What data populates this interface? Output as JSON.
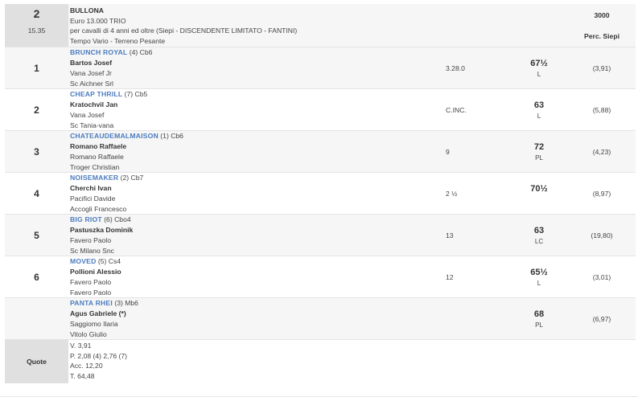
{
  "race": {
    "number": "2",
    "time": "15.35",
    "name": "BULLONA",
    "prize": "Euro 13.000 TRIO",
    "conditions": "per cavalli di 4 anni ed oltre (Siepi -  DISCENDENTE LIMITATO  - FANTINI)",
    "weather": "Tempo Vario - Terreno Pesante",
    "distance": "3000",
    "type": "Perc. Siepi"
  },
  "entries": [
    {
      "pos": "1",
      "horse": "BRUNCH ROYAL",
      "horse_info": "(4) Cb6",
      "jockey": "Bartos Josef",
      "trainer": "Vana Josef Jr",
      "owner": "Sc Aichner Srl",
      "time": "3.28.0",
      "weight": "67½",
      "equip": "L",
      "perc": "(3,91)"
    },
    {
      "pos": "2",
      "horse": "CHEAP THRILL",
      "horse_info": "(7) Cb5",
      "jockey": "Kratochvil Jan",
      "trainer": "Vana Josef",
      "owner": "Sc Tania-vana",
      "time": "C.INC.",
      "weight": "63",
      "equip": "L",
      "perc": "(5,88)"
    },
    {
      "pos": "3",
      "horse": "CHATEAUDEMALMAISON",
      "horse_info": "(1) Cb6",
      "jockey": "Romano Raffaele",
      "trainer": "Romano Raffaele",
      "owner": "Troger Christian",
      "time": "9",
      "weight": "72",
      "equip": "PL",
      "perc": "(4,23)"
    },
    {
      "pos": "4",
      "horse": "NOISEMAKER",
      "horse_info": "(2) Cb7",
      "jockey": "Cherchi Ivan",
      "trainer": "Pacifici Davide",
      "owner": "Accogli Francesco",
      "time": "2 ½",
      "weight": "70½",
      "equip": "",
      "perc": "(8,97)"
    },
    {
      "pos": "5",
      "horse": "BIG RIOT",
      "horse_info": "(6) Cbo4",
      "jockey": "Pastuszka Dominik",
      "trainer": "Favero Paolo",
      "owner": "Sc Milano Snc",
      "time": "13",
      "weight": "63",
      "equip": "LC",
      "perc": "(19,80)"
    },
    {
      "pos": "6",
      "horse": "MOVED",
      "horse_info": "(5) Cs4",
      "jockey": "Pollioni Alessio",
      "trainer": "Favero Paolo",
      "owner": "Favero Paolo",
      "time": "12",
      "weight": "65½",
      "equip": "L",
      "perc": "(3,01)"
    },
    {
      "pos": "",
      "horse": "PANTA RHEI",
      "horse_info": "(3) Mb6",
      "jockey": "Agus Gabriele (*)",
      "trainer": "Saggiomo Ilaria",
      "owner": "Vitolo Giulio",
      "time": "",
      "weight": "68",
      "equip": "PL",
      "perc": "(6,97)"
    }
  ],
  "quote": {
    "label": "Quote",
    "v": "V. 3,91",
    "p": "P. 2,08 (4)  2,76 (7)",
    "acc": "Acc. 12,20",
    "t": "T. 64,48"
  }
}
